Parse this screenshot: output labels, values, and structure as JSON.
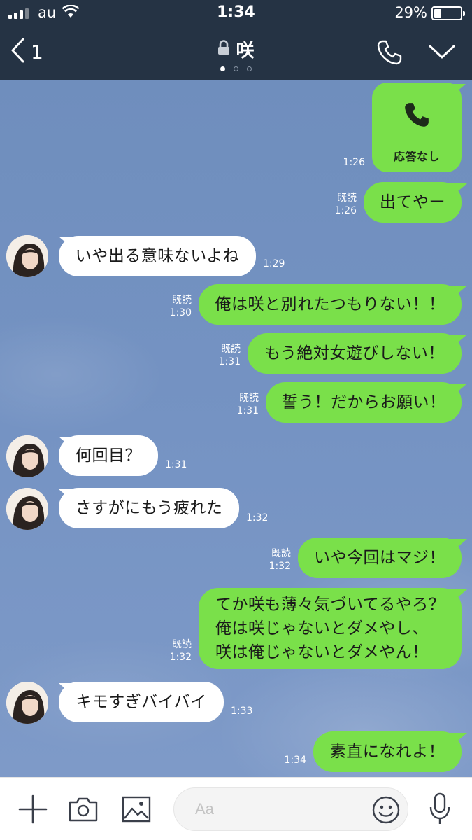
{
  "status_bar": {
    "carrier": "au",
    "time": "1:34",
    "battery_percent": "29%",
    "battery_level": 0.29,
    "signal_bars": 3
  },
  "header": {
    "back_count": "1",
    "title": "咲",
    "page_dots": 3,
    "active_dot": 0,
    "icons": [
      "back-chevron-icon",
      "lock-icon",
      "phone-icon",
      "chevron-down-icon"
    ]
  },
  "messages": [
    {
      "sender": "me",
      "type": "call",
      "label": "応答なし",
      "time": "1:26",
      "read": ""
    },
    {
      "sender": "me",
      "text": "出てやー",
      "read": "既読",
      "time": "1:26"
    },
    {
      "sender": "them",
      "text": "いや出る意味ないよね",
      "time": "1:29"
    },
    {
      "sender": "me",
      "text": "俺は咲と別れたつもりない！！",
      "read": "既読",
      "time": "1:30"
    },
    {
      "sender": "me",
      "text": "もう絶対女遊びしない！",
      "read": "既読",
      "time": "1:31"
    },
    {
      "sender": "me",
      "text": "誓う！だからお願い！",
      "read": "既読",
      "time": "1:31"
    },
    {
      "sender": "them",
      "text": "何回目？",
      "time": "1:31"
    },
    {
      "sender": "them",
      "text": "さすがにもう疲れた",
      "time": "1:32"
    },
    {
      "sender": "me",
      "text": "いや今回はマジ！",
      "read": "既読",
      "time": "1:32"
    },
    {
      "sender": "me",
      "text": "てか咲も薄々気づいてるやろ？\n俺は咲じゃないとダメやし、\n咲は俺じゃないとダメやん！",
      "read": "既読",
      "time": "1:32"
    },
    {
      "sender": "them",
      "text": "キモすぎバイバイ",
      "time": "1:33"
    },
    {
      "sender": "me",
      "text": "素直になれよ！",
      "read": "",
      "time": "1:34"
    }
  ],
  "composer": {
    "placeholder": "Aa",
    "icons": [
      "plus-icon",
      "camera-icon",
      "image-icon",
      "emoji-icon",
      "microphone-icon"
    ]
  },
  "colors": {
    "header_bg": "#253344",
    "chat_bg": "#7390bf",
    "my_bubble": "#7ae04a",
    "their_bubble": "#ffffff"
  }
}
